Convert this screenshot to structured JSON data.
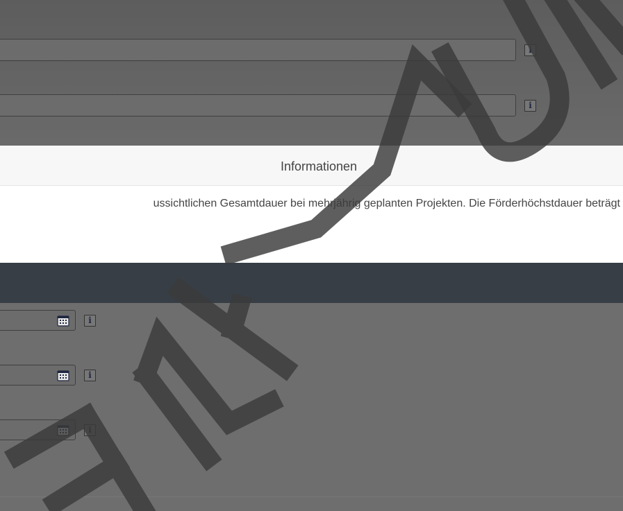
{
  "modal": {
    "title": "Informationen",
    "body": "ussichtlichen Gesamtdauer bei mehrjährig geplanten Projekten. Die Förderhöchstdauer beträgt"
  },
  "watermark": "ENTWURF",
  "icons": {
    "info": "info-icon",
    "calendar": "calendar-icon"
  },
  "info_glyph": "i",
  "colors": {
    "overlay": "#6e6e6e",
    "modal_bg": "#ffffff",
    "modal_header_bg": "#f7f7f7",
    "dark_band": "#373e45",
    "watermark": "#3a3a3a"
  }
}
